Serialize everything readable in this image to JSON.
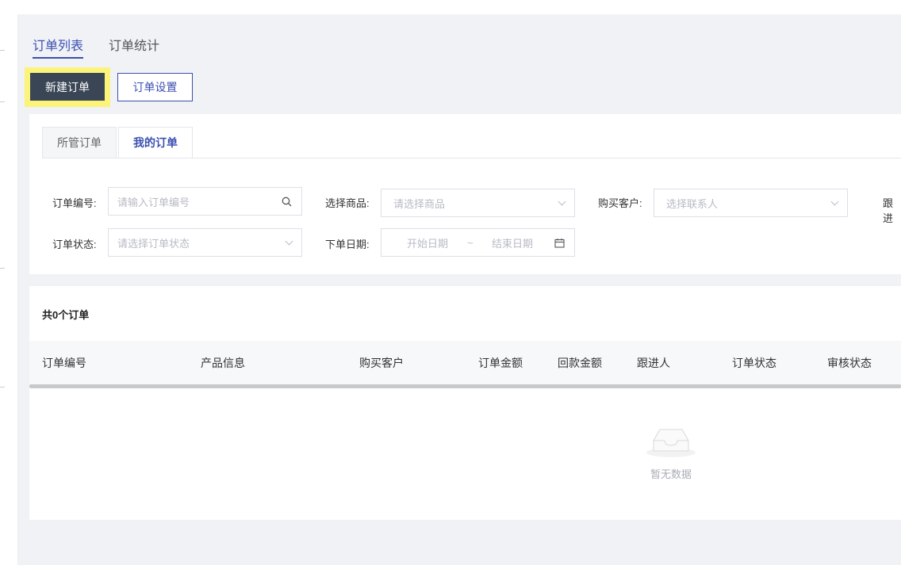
{
  "page_tabs": [
    {
      "label": "订单列表",
      "active": true
    },
    {
      "label": "订单统计",
      "active": false
    }
  ],
  "actions": {
    "new_order": "新建订单",
    "order_settings": "订单设置"
  },
  "sub_tabs": [
    {
      "label": "所管订单",
      "active": false
    },
    {
      "label": "我的订单",
      "active": true
    }
  ],
  "filters": {
    "order_no": {
      "label": "订单编号:",
      "placeholder": "请输入订单编号"
    },
    "product": {
      "label": "选择商品:",
      "placeholder": "请选择商品"
    },
    "customer": {
      "label": "购买客户:",
      "placeholder": "选择联系人"
    },
    "follower": {
      "label": "跟进"
    },
    "status": {
      "label": "订单状态:",
      "placeholder": "请选择订单状态"
    },
    "date": {
      "label": "下单日期:",
      "start_placeholder": "开始日期",
      "separator": "~",
      "end_placeholder": "结束日期"
    }
  },
  "table": {
    "count_text": "共0个订单",
    "columns": [
      "订单编号",
      "产品信息",
      "购买客户",
      "订单金额",
      "回款金额",
      "跟进人",
      "订单状态",
      "审核状态"
    ],
    "rows": [],
    "empty_text": "暂无数据"
  },
  "colors": {
    "accent": "#3b4fb0",
    "primary_button": "#3a4655",
    "highlight": "#fbf37a",
    "background": "#f0f2f6"
  },
  "icons": {
    "search": "search-icon",
    "dropdown": "chevron-down-icon",
    "calendar": "calendar-icon",
    "empty": "empty-inbox-icon"
  }
}
